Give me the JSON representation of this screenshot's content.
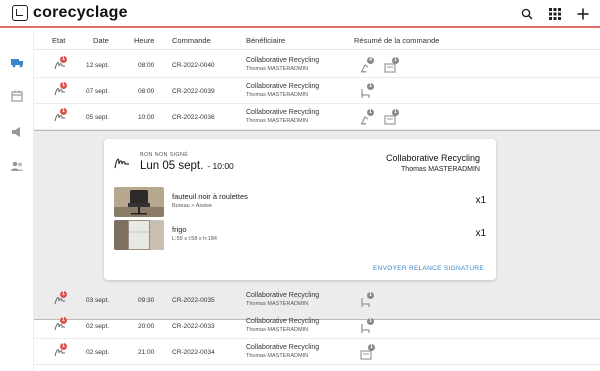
{
  "app": {
    "name": "corecyclage"
  },
  "colors": {
    "accent_bar": "#e2706a",
    "badge_red": "#d9534f",
    "badge_grey": "#888888",
    "link_blue": "#3a86c8"
  },
  "toolbar": {
    "icons": [
      "search-icon",
      "grid-apps-icon",
      "plus-icon"
    ]
  },
  "sidebar": {
    "icons": [
      "truck-icon",
      "calendar-icon",
      "megaphone-icon",
      "users-icon"
    ]
  },
  "table": {
    "headers": {
      "etat": "Etat",
      "date": "Date",
      "heure": "Heure",
      "commande": "Commande",
      "beneficiaire": "Bénéficiaire",
      "resume": "Résumé de la commande"
    },
    "rows_top": [
      {
        "badge": "1",
        "date": "12 sept.",
        "heure": "08:00",
        "commande": "CR-2022-0040",
        "beneficiaire": "Collaborative Recycling",
        "user": "Thomas MASTERADMIN",
        "resume_badges": [
          "4",
          "1"
        ]
      },
      {
        "badge": "1",
        "date": "07 sept.",
        "heure": "08:00",
        "commande": "CR-2022-0039",
        "beneficiaire": "Collaborative Recycling",
        "user": "Thomas MASTERADMIN",
        "resume_badges": [
          "1"
        ]
      },
      {
        "badge": "1",
        "date": "05 sept.",
        "heure": "10:00",
        "commande": "CR-2022-0036",
        "beneficiaire": "Collaborative Recycling",
        "user": "Thomas MASTERADMIN",
        "resume_badges": [
          "1",
          "1"
        ]
      }
    ],
    "rows_bottom": [
      {
        "badge": "1",
        "date": "03 sept.",
        "heure": "09:30",
        "commande": "CR-2022-0035",
        "beneficiaire": "Collaborative Recycling",
        "user": "Thomas MASTERADMIN",
        "resume_badges": [
          "1"
        ]
      },
      {
        "badge": "1",
        "date": "02 sept.",
        "heure": "20:00",
        "commande": "CR-2022-0033",
        "beneficiaire": "Collaborative Recycling",
        "user": "Thomas MASTERADMIN",
        "resume_badges": [
          "1"
        ]
      },
      {
        "badge": "1",
        "date": "02 sept.",
        "heure": "21:00",
        "commande": "CR-2022-0034",
        "beneficiaire": "Collaborative Recycling",
        "user": "Thomas MASTERADMIN",
        "resume_badges": [
          "1"
        ]
      }
    ]
  },
  "detail": {
    "status_label": "BON NON SIGNÉ",
    "date": "Lun 05 sept.",
    "time": "- 10:00",
    "beneficiaire": "Collaborative Recycling",
    "user": "Thomas MASTERADMIN",
    "items": [
      {
        "name": "fauteuil noir à roulettes",
        "sub": "Bureau > Assise",
        "qty": "x1"
      },
      {
        "name": "frigo",
        "sub": "L:59 x l:58 x h:184",
        "qty": "x1"
      }
    ],
    "action_label": "ENVOYER RELANCE SIGNATURE"
  }
}
